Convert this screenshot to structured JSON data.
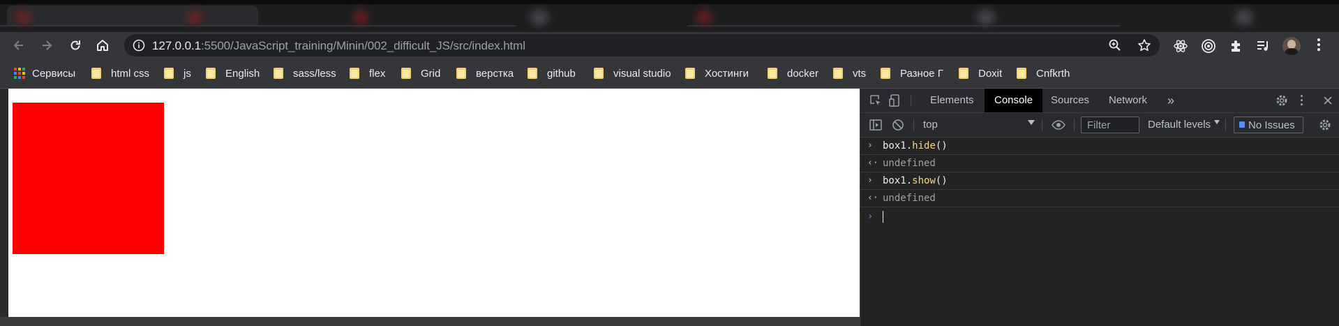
{
  "browser": {
    "address_bar": {
      "host": "127.0.0.1",
      "rest": ":5500/JavaScript_training/Minin/002_difficult_JS/src/index.html"
    },
    "nav": {
      "back_icon": "arrow-left-icon",
      "forward_icon": "arrow-right-icon",
      "reload_icon": "reload-icon",
      "home_icon": "home-icon"
    },
    "omnibox_icons": [
      "site-info-icon",
      "zoom-icon",
      "bookmark-star-icon"
    ],
    "extension_icons": [
      "react-devtools-icon",
      "target-icon",
      "extensions-puzzle-icon",
      "media-control-icon",
      "profile-avatar",
      "menu-dots-icon"
    ]
  },
  "bookmarks": {
    "apps_label": "Сервисы",
    "items": [
      {
        "label": "html css"
      },
      {
        "label": "js"
      },
      {
        "label": "English"
      },
      {
        "label": "sass/less"
      },
      {
        "label": "flex"
      },
      {
        "label": "Grid"
      },
      {
        "label": "верстка"
      },
      {
        "label": "github"
      },
      {
        "label": "visual studio"
      },
      {
        "label": "Хостинги"
      },
      {
        "label": "docker"
      },
      {
        "label": "vts"
      },
      {
        "label": "Разное Г"
      },
      {
        "label": "Doxit"
      },
      {
        "label": "Cnfkrth"
      }
    ]
  },
  "page": {
    "box_color": "#ff0000"
  },
  "devtools": {
    "tabs": [
      {
        "label": "Elements",
        "active": false
      },
      {
        "label": "Console",
        "active": true
      },
      {
        "label": "Sources",
        "active": false
      },
      {
        "label": "Network",
        "active": false
      }
    ],
    "more_tabs_label": "»",
    "filterbar": {
      "context": "top",
      "filter_placeholder": "Filter",
      "levels_label": "Default levels",
      "issues_label": "No Issues"
    },
    "console": [
      {
        "kind": "input",
        "object": "box1",
        "method": "hide",
        "suffix": "()"
      },
      {
        "kind": "result",
        "text": "undefined"
      },
      {
        "kind": "input",
        "object": "box1",
        "method": "show",
        "suffix": "()"
      },
      {
        "kind": "result",
        "text": "undefined"
      }
    ],
    "prompt_symbol": "›",
    "input_arrow": "›",
    "result_arrow": "‹·"
  },
  "colors": {
    "chrome_dark": "#202124",
    "toolbar": "#35363a",
    "devtools_bg": "#242424",
    "method_yellow": "#f9d57f",
    "accent_blue": "#4d8ef7"
  }
}
